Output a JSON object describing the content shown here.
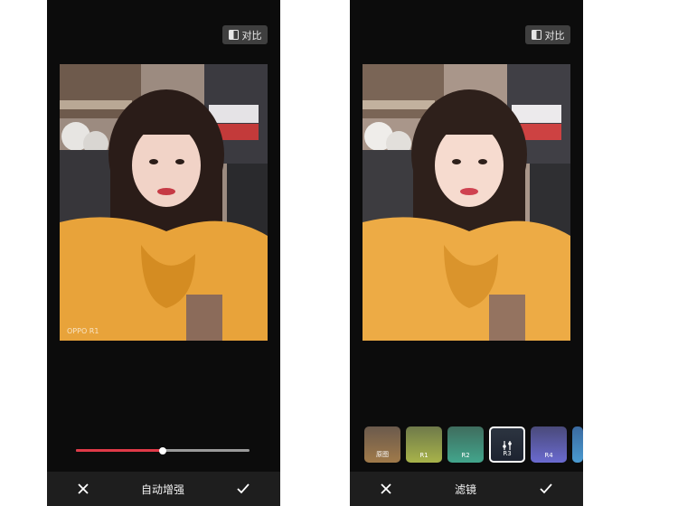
{
  "left_screen": {
    "compare_label": "对比",
    "title": "自动增强",
    "slider_value_percent": 50,
    "watermark": "OPPO R1"
  },
  "right_screen": {
    "compare_label": "对比",
    "title": "滤镜",
    "filters": [
      {
        "label": "原图"
      },
      {
        "label": "R1"
      },
      {
        "label": "R2"
      },
      {
        "label": "R3",
        "selected": true
      },
      {
        "label": "R4"
      }
    ]
  },
  "icons": {
    "compare": "compare-icon",
    "close": "close-icon",
    "confirm": "check-icon",
    "adjust": "adjust-icon"
  }
}
